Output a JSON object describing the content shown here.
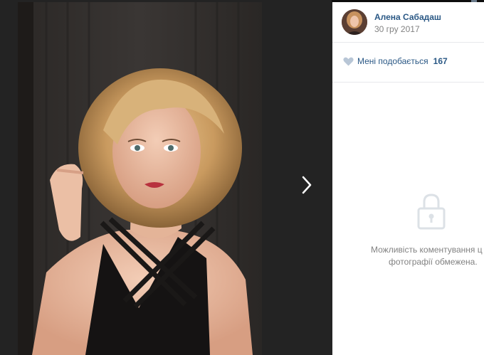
{
  "viewer": {
    "photo_alt": "Portrait photo",
    "next_icon": "chevron-right-icon"
  },
  "post": {
    "author_name": "Алена Сабадаш",
    "date": "30 гру 2017"
  },
  "likes": {
    "label": "Мені подобається",
    "count": "167",
    "icon": "heart-icon"
  },
  "comments": {
    "closed_line1": "Можливість коментування ц",
    "closed_line2": "фотографії обмежена.",
    "icon": "lock-icon"
  },
  "colors": {
    "link": "#2a5885",
    "muted": "#828282",
    "backdrop": "#232323"
  }
}
